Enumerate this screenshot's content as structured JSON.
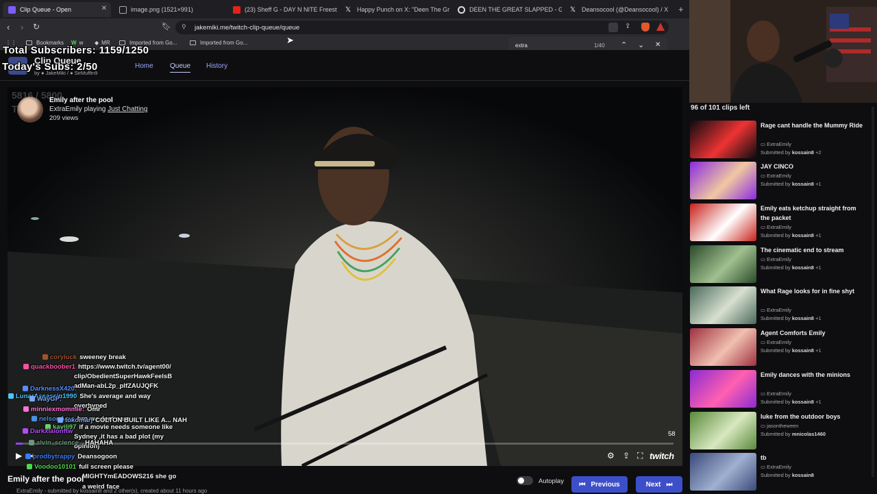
{
  "browser": {
    "tabs": [
      {
        "label": "Clip Queue - Open",
        "active": true
      },
      {
        "label": "image.png (1521×991)"
      },
      {
        "label": "(23) Sheff G - DAY N NITE Freestyle ("
      },
      {
        "label": "Happy Punch on X: \"Deen The Great"
      },
      {
        "label": "DEEN THE GREAT SLAPPED - Google"
      },
      {
        "label": "Deansocool (@Deansocool) / X"
      }
    ],
    "url": "jakemiki.me/twitch-clip-queue/queue",
    "bookmarks": [
      "Bookmarks",
      "w",
      "MR",
      "Imported from Go...",
      "Imported from Go..."
    ],
    "find": {
      "query": "extra",
      "count": "1/40"
    }
  },
  "app": {
    "title": "Clip Queue",
    "credits_prefix": "by",
    "credits_author1": "JakeMiki",
    "credits_sep": "/",
    "credits_author2": "SirMuffin9",
    "nav": {
      "home": "Home",
      "queue": "Queue",
      "history": "History"
    }
  },
  "overlay": {
    "subs_total": "Total Subscribers: 1159/1250",
    "subs_today": "Today's Subs: 2/50",
    "dim_counter": "5816 / 5800",
    "dim_counter2": "T"
  },
  "player": {
    "clip_title": "Emily after the pool",
    "channel": "ExtraEmily",
    "playing_word": "playing",
    "category": "Just Chatting",
    "views": "209 views",
    "time_left": "58",
    "progress": 0.01,
    "brand": "twitch"
  },
  "chat": [
    {
      "user": "coryluck",
      "msg": "sweeney break",
      "color": "#a0522d"
    },
    {
      "user": "quackboober1",
      "msg": "https://www.twitch.tv/agent00/",
      "color": "#ff4fa3"
    },
    {
      "user": "",
      "msg": "clip/ObedientSuperHawkFeelsB",
      "color": "#ffffff"
    },
    {
      "user": "",
      "msg": "adMan-abL2p_pIfZAUJQFK",
      "color": "#ffffff"
    },
    {
      "user": "DarknessX420:",
      "msg": "",
      "color": "#5b8cff"
    },
    {
      "user": "LunarAssassin1990",
      "msg": "She's average and way",
      "color": "#4fc3f7"
    },
    {
      "user": "WayGP:",
      "msg": "",
      "color": "#7aa7ff"
    },
    {
      "user": "",
      "msg": "overhyped",
      "color": "#ffffff"
    },
    {
      "user": "minniexmommie:",
      "msg": "Omr",
      "color": "#ff6fd8"
    },
    {
      "user": "nelsonAmp",
      "msg": "bro we dont care",
      "color": "#4a90e2"
    },
    {
      "user": "tokomarj",
      "msg": "COLTON BUILT LIKE A... NAH",
      "color": "#7aa7ff"
    },
    {
      "user": "kavili97",
      "msg": "if a movie needs someone like",
      "color": "#6dd46d"
    },
    {
      "user": "Darkxiaionftw",
      "msg": "",
      "color": "#b44bff"
    },
    {
      "user": "",
      "msg": "Sydney ,it has a bad plot (my",
      "color": "#ffffff"
    },
    {
      "user": "",
      "msg": "opinion)",
      "color": "#ffffff"
    },
    {
      "user": "alvin_science_",
      "msg": "HAHAHA",
      "color": "#6a9a7a"
    },
    {
      "user": "prodbytrappy",
      "msg": "Deansogoon",
      "color": "#3a7bff"
    },
    {
      "user": "Voodoo10101",
      "msg": "full screen please",
      "color": "#4cd84c"
    },
    {
      "user": "",
      "msg": "MIGHTYmEADOWS216 she go",
      "color": "#ffffff"
    },
    {
      "user": "",
      "msg": "a weird face",
      "color": "#ffffff"
    }
  ],
  "bottom": {
    "clip_title": "Emily after the pool",
    "meta": "ExtraEmily - submitted by kossain8 and 2 other(s), created about 11 hours ago",
    "autoplay": "Autoplay",
    "previous": "Previous",
    "next": "Next"
  },
  "queue": {
    "count_label": "96 of 101 clips left",
    "items": [
      {
        "title": "Rage cant handle the Mummy Ride",
        "channel": "ExtraEmily",
        "submitter": "kossain8",
        "extra": "+2"
      },
      {
        "title": "JAY CINCO",
        "channel": "ExtraEmily",
        "submitter": "kossain8",
        "extra": "+1"
      },
      {
        "title": "Emily eats ketchup straight from the packet",
        "channel": "ExtraEmily",
        "submitter": "kossain8",
        "extra": "+1"
      },
      {
        "title": "The cinematic end to stream",
        "channel": "ExtraEmily",
        "submitter": "kossain8",
        "extra": "+1"
      },
      {
        "title": "What Rage looks for in fine shyt",
        "channel": "ExtraEmily",
        "submitter": "kossain8",
        "extra": "+1"
      },
      {
        "title": "Agent Comforts Emily",
        "channel": "ExtraEmily",
        "submitter": "kossain8",
        "extra": "+1"
      },
      {
        "title": "Emily dances with the minions",
        "channel": "ExtraEmily",
        "submitter": "kossain8",
        "extra": "+1"
      },
      {
        "title": "luke from the outdoor boys",
        "channel": "jasontheween",
        "submitter": "mnicolas1460",
        "extra": ""
      },
      {
        "title": "tb",
        "channel": "ExtraEmily",
        "submitter": "kossain8",
        "extra": ""
      }
    ],
    "submitted_by": "Submitted by"
  },
  "colors": {
    "accent": "#3d4fc8",
    "link": "#9aa8ff",
    "background": "#0e0e10"
  }
}
